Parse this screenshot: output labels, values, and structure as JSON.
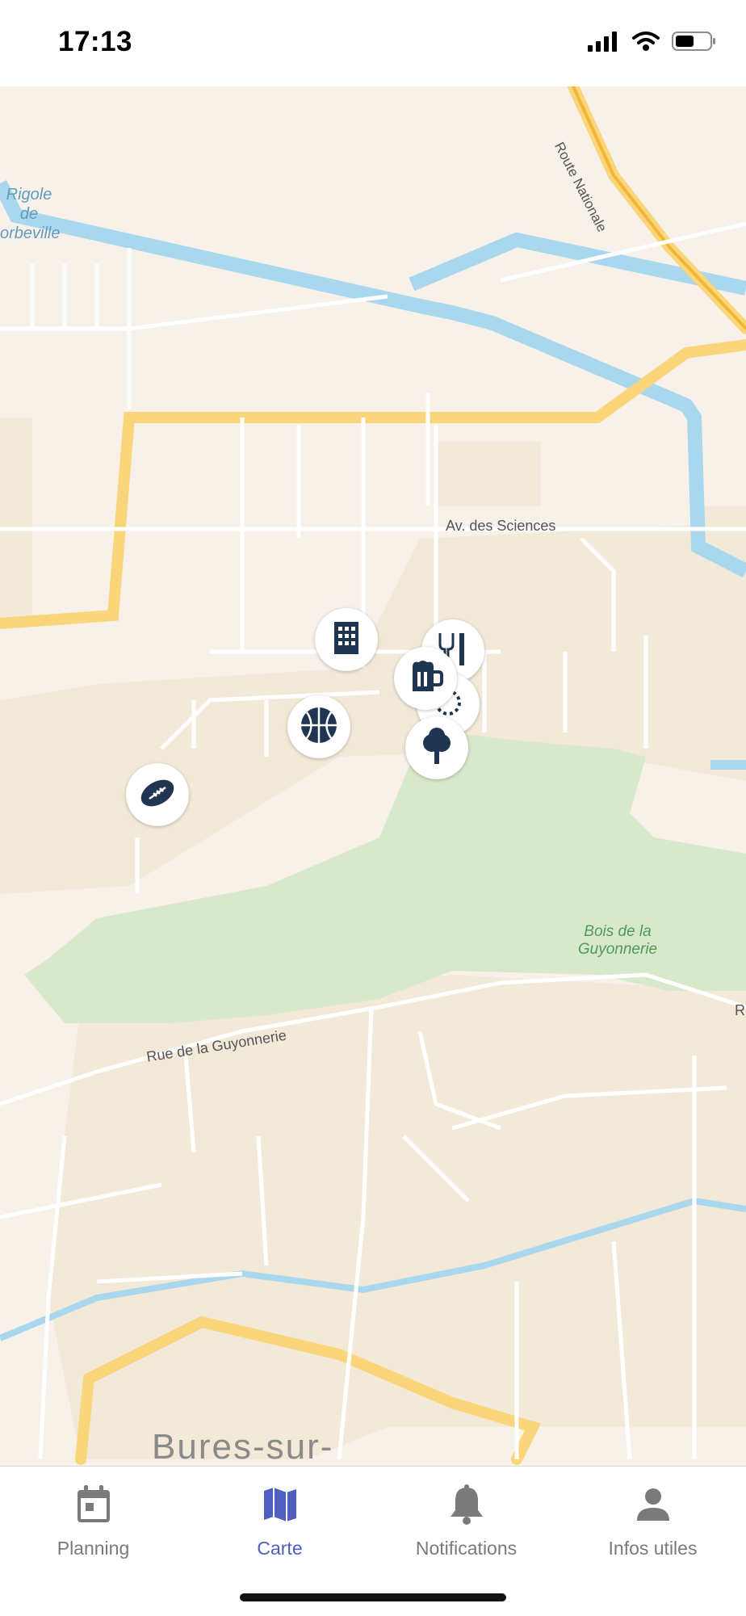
{
  "status_bar": {
    "time": "17:13"
  },
  "map": {
    "labels": {
      "rigole_line1": "Rigole",
      "rigole_line2": "de",
      "rigole_line3": "orbeville",
      "route_nationale": "Route Nationale",
      "av_sciences": "Av. des Sciences",
      "bois_line1": "Bois de la",
      "bois_line2": "Guyonnerie",
      "rue_guyonnerie": "Rue de la Guyonnerie",
      "bures": "Bures-sur-",
      "edge_r": "R"
    },
    "markers": [
      {
        "icon": "building-icon"
      },
      {
        "icon": "restaurant-icon"
      },
      {
        "icon": "beer-mug-icon"
      },
      {
        "icon": "basketball-icon"
      },
      {
        "icon": "tree-icon"
      },
      {
        "icon": "football-icon"
      }
    ]
  },
  "tabbar": {
    "tabs": [
      {
        "label": "Planning",
        "icon": "calendar-icon",
        "active": false
      },
      {
        "label": "Carte",
        "icon": "map-icon",
        "active": true
      },
      {
        "label": "Notifications",
        "icon": "bell-icon",
        "active": false
      },
      {
        "label": "Infos utiles",
        "icon": "person-icon",
        "active": false
      }
    ]
  },
  "colors": {
    "accent": "#4f5fbf",
    "marker_icon": "#1f3551",
    "water": "#a9d8ee",
    "park": "#d8e8cb",
    "major_road": "#fbd57a",
    "tab_inactive": "#7a7a7a"
  }
}
